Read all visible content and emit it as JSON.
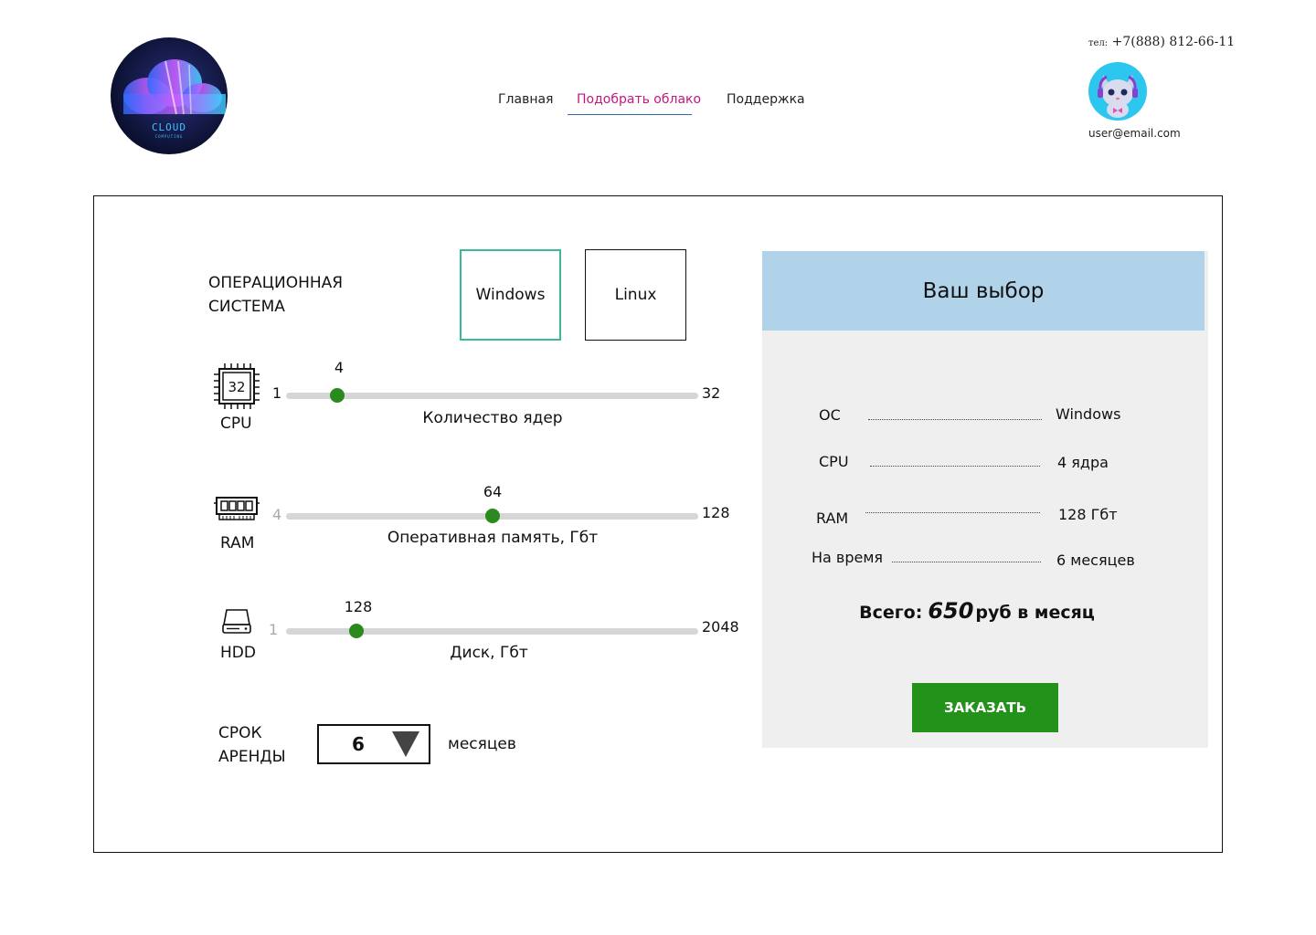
{
  "header": {
    "logo_text": "CLOUD",
    "logo_subtext": "COMPUTING",
    "nav": [
      {
        "label": "Главная",
        "active": false
      },
      {
        "label": "Подобрать облако",
        "active": true
      },
      {
        "label": "Поддержка",
        "active": false
      }
    ],
    "phone_label": "тел:",
    "phone": "+7(888) 812-66-11",
    "email": "user@email.com"
  },
  "os": {
    "label_line1": "ОПЕРАЦИОННАЯ",
    "label_line2": "СИСТЕМА",
    "options": [
      "Windows",
      "Linux"
    ],
    "selected": "Windows"
  },
  "sliders": [
    {
      "icon_text": "32",
      "label": "CPU",
      "min_label": "1",
      "max_label": "32",
      "value": "4",
      "caption": "Количество ядер",
      "fraction": 0.125
    },
    {
      "icon_text": "",
      "label": "RAM",
      "min_label": "4",
      "max_label": "128",
      "value": "64",
      "caption": "Оперативная память, Гбт",
      "fraction": 0.5
    },
    {
      "icon_text": "",
      "label": "HDD",
      "min_label": "1",
      "max_label": "2048",
      "value": "128",
      "caption": "Диск, Гбт",
      "fraction": 0.17
    }
  ],
  "rent": {
    "label_line1": "СРОК",
    "label_line2": "АРЕНДЫ",
    "value": "6",
    "unit": "месяцев"
  },
  "summary": {
    "title": "Ваш выбор",
    "rows": [
      {
        "key": "ОС",
        "value": "Windows"
      },
      {
        "key": "CPU",
        "value": "4 ядра"
      },
      {
        "key": "RAM",
        "value": "128 Гбт"
      },
      {
        "key": "На время",
        "value": "6 месяцев"
      }
    ],
    "total_label": "Всего:",
    "total_amount": "650",
    "total_unit": "руб в месяц",
    "order_button": "ЗАКАЗАТЬ"
  },
  "colors": {
    "accent_nav": "#c2187e",
    "slider_thumb": "#2a8a1e",
    "order_button": "#23921a",
    "summary_header": "#b0d3ea",
    "os_selected_border": "#3ab89a"
  }
}
